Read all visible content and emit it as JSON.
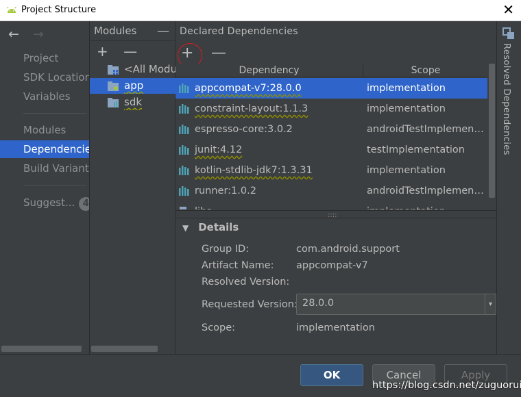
{
  "window": {
    "title": "Project Structure",
    "close_glyph": "✕"
  },
  "nav": {
    "back": "←",
    "forward": "→",
    "items": [
      "Project",
      "SDK Location",
      "Variables",
      "Modules",
      "Dependencies",
      "Build Variants",
      "Suggest..."
    ],
    "selected": "Dependencies",
    "suggest_badge": "4"
  },
  "modules": {
    "header": "Modules",
    "minus": "—",
    "add": "+",
    "remove": "—",
    "items": [
      "<All Modules>",
      "app",
      "sdk"
    ],
    "selected": "app"
  },
  "deps": {
    "header": "Declared Dependencies",
    "add": "+",
    "remove": "—",
    "columns": [
      "Dependency",
      "Scope"
    ],
    "rows": [
      {
        "name": "appcompat-v7:28.0.0",
        "scope": "implementation"
      },
      {
        "name": "constraint-layout:1.1.3",
        "scope": "implementation"
      },
      {
        "name": "espresso-core:3.0.2",
        "scope": "androidTestImplementation"
      },
      {
        "name": "junit:4.12",
        "scope": "testImplementation"
      },
      {
        "name": "kotlin-stdlib-jdk7:1.3.31",
        "scope": "implementation"
      },
      {
        "name": "runner:1.0.2",
        "scope": "androidTestImplementation"
      },
      {
        "name": "libs",
        "scope": "implementation"
      }
    ],
    "selected_row": 0,
    "splitter_grip": "::::"
  },
  "details": {
    "title": "Details",
    "toggle": "▼",
    "group_id_label": "Group ID:",
    "group_id": "com.android.support",
    "artifact_label": "Artifact Name:",
    "artifact": "appcompat-v7",
    "resolved_label": "Resolved Version:",
    "resolved": "",
    "requested_label": "Requested Version:",
    "requested": "28.0.0",
    "dropdown": "▾",
    "scope_label": "Scope:",
    "scope": "implementation"
  },
  "right_strip": {
    "label": "Resolved Dependencies"
  },
  "buttons": {
    "ok": "OK",
    "cancel": "Cancel",
    "apply": "Apply"
  },
  "watermark": "https://blog.csdn.net/zuguorui",
  "colors": {
    "selection": "#2f65ca",
    "background": "#3c3f41",
    "annotation_circle": "#d81b1b",
    "android_green": "#a4c639",
    "library_icon": "#4fa3b8"
  }
}
